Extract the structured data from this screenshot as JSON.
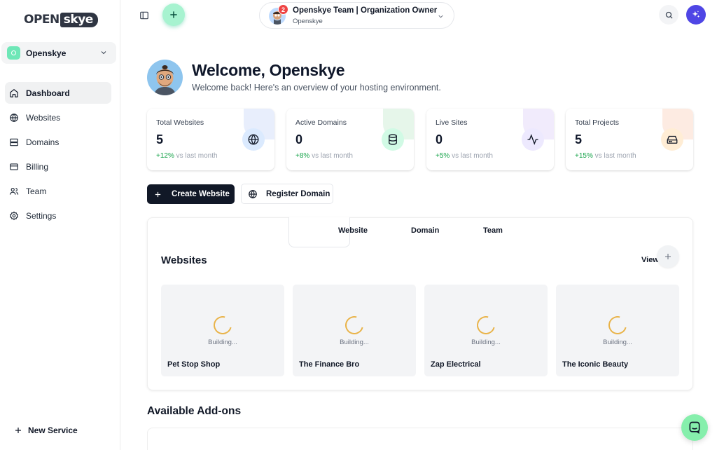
{
  "brand": {
    "logo_part1": "OPEN",
    "logo_part2": "skye"
  },
  "sidebar": {
    "org_name": "Openskye",
    "items": [
      {
        "label": "Dashboard",
        "icon": "home-icon",
        "active": true
      },
      {
        "label": "Websites",
        "icon": "globe-icon"
      },
      {
        "label": "Domains",
        "icon": "server-icon"
      },
      {
        "label": "Billing",
        "icon": "credit-card-icon"
      },
      {
        "label": "Team",
        "icon": "users-icon"
      },
      {
        "label": "Settings",
        "icon": "gear-icon"
      }
    ],
    "new_service_label": "New Service"
  },
  "topbar": {
    "team_title": "Openskye Team | Organization Owner",
    "team_subtitle": "Openskye",
    "notification_count": "2"
  },
  "welcome": {
    "title": "Welcome, Openskye",
    "subtitle": "Welcome back! Here's an overview of your hosting environment."
  },
  "stats": [
    {
      "label": "Total Websites",
      "value": "5",
      "change": "+12%",
      "change_suffix": "vs last month",
      "icon": "globe-icon",
      "accent": "#dbeafe",
      "icon_bg": "#dbeafe"
    },
    {
      "label": "Active Domains",
      "value": "0",
      "change": "+8%",
      "change_suffix": "vs last month",
      "icon": "database-icon",
      "accent": "#dcfce7",
      "icon_bg": "#d1fae5"
    },
    {
      "label": "Live Sites",
      "value": "0",
      "change": "+5%",
      "change_suffix": "vs last month",
      "icon": "activity-icon",
      "accent": "#ede9fe",
      "icon_bg": "#ede9fe"
    },
    {
      "label": "Total Projects",
      "value": "5",
      "change": "+15%",
      "change_suffix": "vs last month",
      "icon": "hard-drive-icon",
      "accent": "#ffe4d6",
      "icon_bg": "#ffedd5"
    }
  ],
  "actions": {
    "create_label": "Create Website",
    "register_label": "Register Domain"
  },
  "panel": {
    "tabs": [
      "Website",
      "Domain",
      "Team"
    ],
    "title": "Websites",
    "view_label": "View"
  },
  "websites": [
    {
      "name": "Pet Stop Shop",
      "status": "Building..."
    },
    {
      "name": "The Finance Bro",
      "status": "Building..."
    },
    {
      "name": "Zap Electrical",
      "status": "Building..."
    },
    {
      "name": "The Iconic Beauty",
      "status": "Building..."
    }
  ],
  "addons": {
    "title": "Available Add-ons"
  }
}
